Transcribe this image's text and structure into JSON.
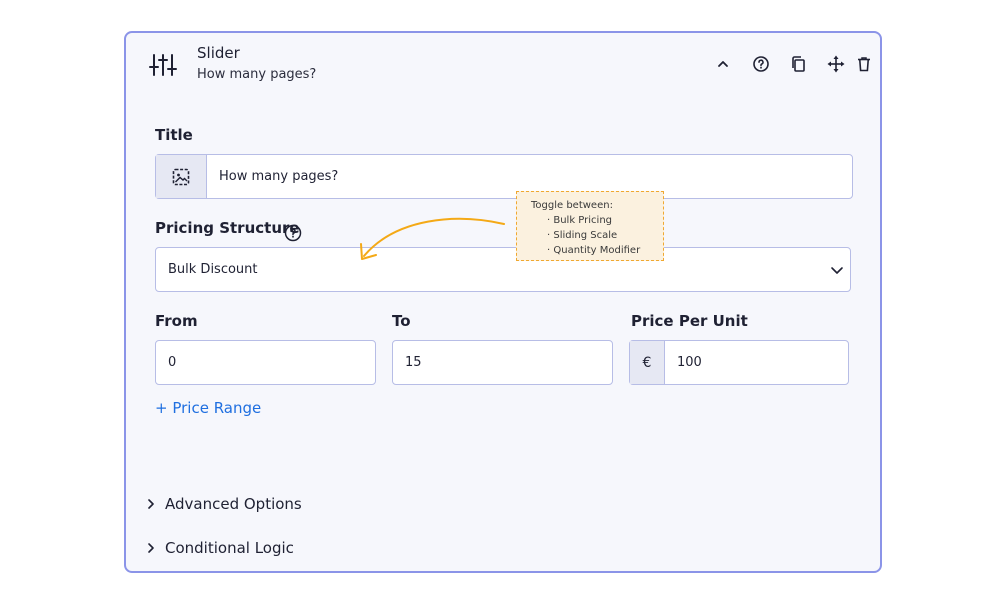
{
  "header": {
    "icon": "sliders-icon",
    "title": "Slider",
    "subtitle": "How many pages?",
    "tools": [
      "chevron-up-icon",
      "help-icon",
      "copy-icon",
      "move-icon",
      "trash-icon"
    ]
  },
  "title_field": {
    "label": "Title",
    "value": "How many pages?",
    "addon_icon": "image-icon"
  },
  "pricing": {
    "label": "Pricing Structure",
    "selected": "Bulk Discount"
  },
  "note": {
    "heading": "Toggle between:",
    "items": [
      "Bulk Pricing",
      "Sliding Scale",
      "Quantity Modifier"
    ]
  },
  "range": {
    "from_label": "From",
    "from_value": "0",
    "to_label": "To",
    "to_value": "15",
    "price_label": "Price Per Unit",
    "currency": "€",
    "price_value": "100",
    "add_label": "+ Price Range"
  },
  "sections": {
    "advanced": "Advanced Options",
    "conditional": "Conditional Logic"
  },
  "colors": {
    "accent": "#8b94e8",
    "link": "#1f6fe0",
    "note_border": "#f0a830",
    "arrow": "#f4a916"
  }
}
